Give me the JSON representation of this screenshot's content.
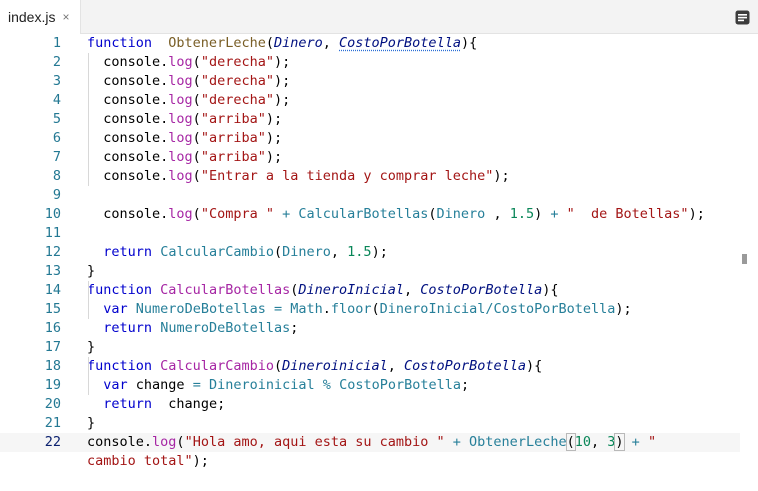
{
  "tab": {
    "filename": "index.js",
    "close_glyph": "×"
  },
  "toolbar": {
    "menu_icon": "list-icon"
  },
  "editor": {
    "active_line": 22,
    "lines": [
      {
        "n": "1",
        "spans": [
          [
            "kw",
            "function"
          ],
          [
            "",
            "  "
          ],
          [
            "fn",
            "ObtenerLeche"
          ],
          [
            "",
            "("
          ],
          [
            "prm",
            "Dinero"
          ],
          [
            "",
            ", "
          ],
          [
            "prm wavy",
            "CostoPorBotella"
          ],
          [
            "",
            "){"
          ]
        ]
      },
      {
        "n": "2",
        "spans": [
          [
            "",
            "  console."
          ],
          [
            "dn",
            "log"
          ],
          [
            "",
            "("
          ],
          [
            "str",
            "\"derecha\""
          ],
          [
            "",
            ");"
          ]
        ]
      },
      {
        "n": "3",
        "spans": [
          [
            "",
            "  console."
          ],
          [
            "dn",
            "log"
          ],
          [
            "",
            "("
          ],
          [
            "str",
            "\"derecha\""
          ],
          [
            "",
            ");"
          ]
        ]
      },
      {
        "n": "4",
        "spans": [
          [
            "",
            "  console."
          ],
          [
            "dn",
            "log"
          ],
          [
            "",
            "("
          ],
          [
            "str",
            "\"derecha\""
          ],
          [
            "",
            ");"
          ]
        ]
      },
      {
        "n": "5",
        "spans": [
          [
            "",
            "  console."
          ],
          [
            "dn",
            "log"
          ],
          [
            "",
            "("
          ],
          [
            "str",
            "\"arriba\""
          ],
          [
            "",
            ");"
          ]
        ]
      },
      {
        "n": "6",
        "spans": [
          [
            "",
            "  console."
          ],
          [
            "dn",
            "log"
          ],
          [
            "",
            "("
          ],
          [
            "str",
            "\"arriba\""
          ],
          [
            "",
            ");"
          ]
        ]
      },
      {
        "n": "7",
        "spans": [
          [
            "",
            "  console."
          ],
          [
            "dn",
            "log"
          ],
          [
            "",
            "("
          ],
          [
            "str",
            "\"arriba\""
          ],
          [
            "",
            ");"
          ]
        ]
      },
      {
        "n": "8",
        "spans": [
          [
            "",
            "  console."
          ],
          [
            "dn",
            "log"
          ],
          [
            "",
            "("
          ],
          [
            "str",
            "\"Entrar a la tienda y comprar leche\""
          ],
          [
            "",
            ");"
          ]
        ]
      },
      {
        "n": "9",
        "spans": []
      },
      {
        "n": "10",
        "spans": [
          [
            "",
            "  console."
          ],
          [
            "dn",
            "log"
          ],
          [
            "",
            "("
          ],
          [
            "str",
            "\"Compra \""
          ],
          [
            "id",
            " + "
          ],
          [
            "id",
            "CalcularBotellas"
          ],
          [
            "",
            "("
          ],
          [
            "id",
            "Dinero"
          ],
          [
            "",
            " , "
          ],
          [
            "num",
            "1.5"
          ],
          [
            "",
            ") "
          ],
          [
            "id",
            "+ "
          ],
          [
            "str",
            "\"  de Botellas\""
          ],
          [
            "",
            ");"
          ]
        ]
      },
      {
        "n": "11",
        "spans": []
      },
      {
        "n": "12",
        "spans": [
          [
            "",
            "  "
          ],
          [
            "kw",
            "return"
          ],
          [
            "",
            " "
          ],
          [
            "id",
            "CalcularCambio"
          ],
          [
            "",
            "("
          ],
          [
            "id",
            "Dinero"
          ],
          [
            "",
            ", "
          ],
          [
            "num",
            "1.5"
          ],
          [
            "",
            ");"
          ]
        ]
      },
      {
        "n": "13",
        "spans": [
          [
            "",
            "}"
          ]
        ]
      },
      {
        "n": "14",
        "spans": [
          [
            "kw",
            "function"
          ],
          [
            "",
            " "
          ],
          [
            "dn",
            "CalcularBotellas"
          ],
          [
            "",
            "("
          ],
          [
            "prm",
            "DineroInicial"
          ],
          [
            "",
            ", "
          ],
          [
            "prm",
            "CostoPorBotella"
          ],
          [
            "",
            "){"
          ]
        ]
      },
      {
        "n": "15",
        "spans": [
          [
            "",
            "  "
          ],
          [
            "kw",
            "var"
          ],
          [
            "",
            " "
          ],
          [
            "id",
            "NumeroDeBotellas"
          ],
          [
            "id",
            " = "
          ],
          [
            "id",
            "Math"
          ],
          [
            "",
            "."
          ],
          [
            "id",
            "floor"
          ],
          [
            "",
            "("
          ],
          [
            "id",
            "DineroInicial"
          ],
          [
            "id",
            "/"
          ],
          [
            "id",
            "CostoPorBotella"
          ],
          [
            "",
            ");"
          ]
        ]
      },
      {
        "n": "16",
        "spans": [
          [
            "",
            "  "
          ],
          [
            "kw",
            "return"
          ],
          [
            "",
            " "
          ],
          [
            "id",
            "NumeroDeBotellas"
          ],
          [
            "",
            ";"
          ]
        ]
      },
      {
        "n": "17",
        "spans": [
          [
            "",
            "}"
          ]
        ]
      },
      {
        "n": "18",
        "spans": [
          [
            "kw",
            "function"
          ],
          [
            "",
            " "
          ],
          [
            "dn",
            "CalcularCambio"
          ],
          [
            "",
            "("
          ],
          [
            "prm",
            "Dineroinicial"
          ],
          [
            "",
            ", "
          ],
          [
            "prm",
            "CostoPorBotella"
          ],
          [
            "",
            "){"
          ]
        ]
      },
      {
        "n": "19",
        "spans": [
          [
            "",
            "  "
          ],
          [
            "kw",
            "var"
          ],
          [
            "",
            " change "
          ],
          [
            "id",
            "="
          ],
          [
            "",
            " "
          ],
          [
            "id",
            "Dineroinicial"
          ],
          [
            "",
            " "
          ],
          [
            "id",
            "%"
          ],
          [
            "",
            " "
          ],
          [
            "id",
            "CostoPorBotella"
          ],
          [
            "",
            ";"
          ]
        ]
      },
      {
        "n": "20",
        "spans": [
          [
            "",
            "  "
          ],
          [
            "kw",
            "return"
          ],
          [
            "",
            "  change;"
          ]
        ]
      },
      {
        "n": "21",
        "spans": [
          [
            "",
            "}"
          ]
        ]
      },
      {
        "n": "22",
        "spans": [
          [
            "",
            "console."
          ],
          [
            "dn",
            "log"
          ],
          [
            "",
            "("
          ],
          [
            "str",
            "\"Hola amo, aqui esta su cambio \""
          ],
          [
            "id",
            " + "
          ],
          [
            "id",
            "ObtenerLeche"
          ],
          [
            "br",
            "("
          ],
          [
            "num",
            "10"
          ],
          [
            "",
            ", "
          ],
          [
            "num",
            "3"
          ],
          [
            "br",
            ")"
          ],
          [
            "id",
            " + "
          ],
          [
            "str",
            "\""
          ]
        ]
      },
      {
        "n": "",
        "spans": [
          [
            "str",
            "cambio total\""
          ],
          [
            "",
            ");"
          ]
        ]
      }
    ]
  }
}
